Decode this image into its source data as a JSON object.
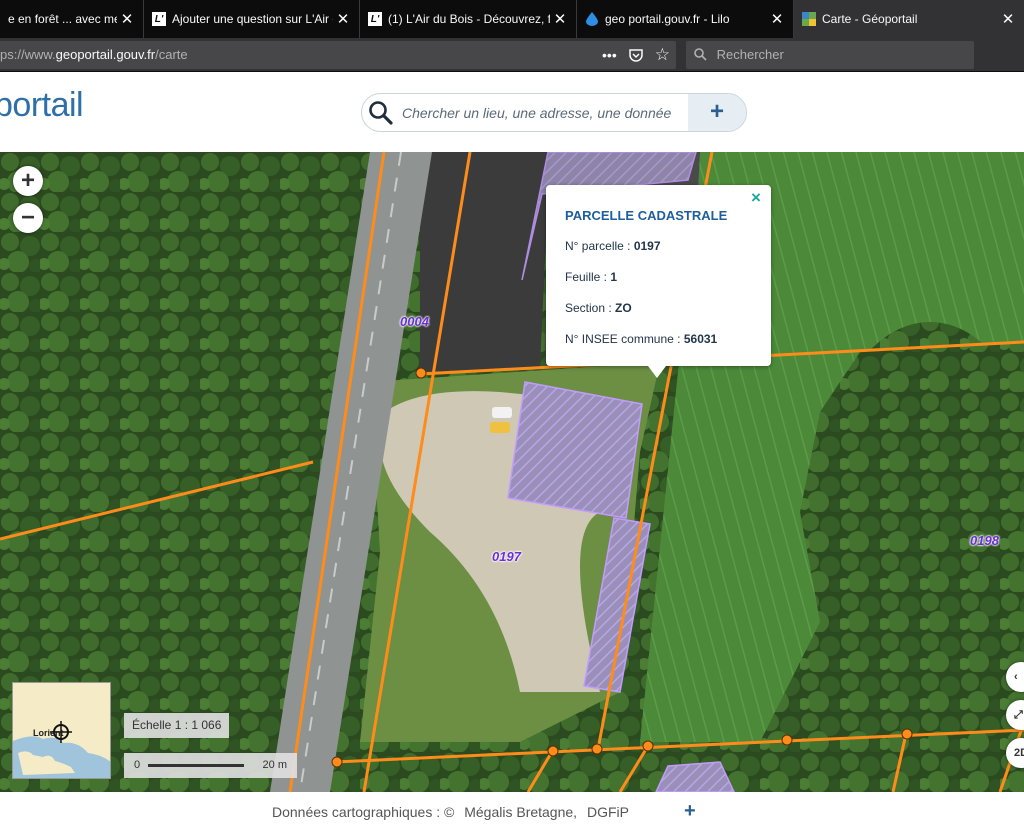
{
  "browser": {
    "tabs": [
      {
        "title": "e en forêt ... avec mes",
        "favicon": "",
        "active": false
      },
      {
        "title": "Ajouter une question sur L'Air d",
        "favicon": "L'",
        "active": false
      },
      {
        "title": "(1) L'Air du Bois - Découvrez, fa",
        "favicon": "L'",
        "active": false
      },
      {
        "title": "geo portail.gouv.fr - Lilo",
        "favicon": "drop-icon",
        "active": false
      },
      {
        "title": "Carte - Géoportail",
        "favicon": "map-icon",
        "active": true
      }
    ],
    "url_prefix": "ps://www.",
    "url_domain": "geoportail.gouv.fr",
    "url_path": "/carte",
    "search_placeholder": "Rechercher",
    "url_actions": {
      "more": "•••",
      "pocket": "pocket-icon",
      "bookmark": "☆"
    }
  },
  "site": {
    "logo": "portail",
    "search_placeholder": "Chercher un lieu, une adresse, une donnée",
    "search_plus": "+"
  },
  "map": {
    "zoom_in": "+",
    "zoom_out": "−",
    "parcel_labels": {
      "p0004": "0004",
      "p0197": "0197",
      "p0198": "0198"
    },
    "popup": {
      "title": "PARCELLE CADASTRALE",
      "close": "×",
      "rows": [
        {
          "label": "N° parcelle : ",
          "value": "0197"
        },
        {
          "label": "Feuille : ",
          "value": "1"
        },
        {
          "label": "Section : ",
          "value": "ZO"
        },
        {
          "label": "N° INSEE commune : ",
          "value": "56031"
        }
      ]
    },
    "overview_place": "Lorient",
    "scale_text": "Échelle 1 : 1 066",
    "scalebar": {
      "min": "0",
      "max": "20 m"
    },
    "right_controls": {
      "arrow": "‹",
      "fullscreen": "⤢",
      "mode": "2D"
    }
  },
  "footer": {
    "credits_label": "Données cartographiques : ©",
    "credit1": "Mégalis Bretagne,",
    "credit2": "DGFiP",
    "plus": "+"
  },
  "colors": {
    "parcel_line": "#ff8c1a",
    "parcel_label": "#6b2fd6",
    "popup_title": "#1f5e9c",
    "logo": "#2d6fa8"
  }
}
